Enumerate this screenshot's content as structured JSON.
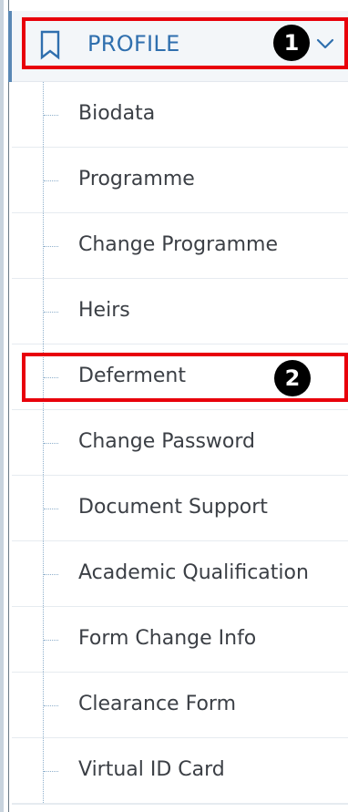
{
  "header": {
    "label": "PROFILE",
    "icon": "bookmark-icon",
    "toggle_icon": "chevron-down-icon",
    "accent_color": "#2f6fae"
  },
  "menu": {
    "items": [
      {
        "label": "Biodata"
      },
      {
        "label": "Programme"
      },
      {
        "label": "Change Programme"
      },
      {
        "label": "Heirs"
      },
      {
        "label": "Deferment"
      },
      {
        "label": "Change Password"
      },
      {
        "label": "Document Support"
      },
      {
        "label": "Academic Qualification"
      },
      {
        "label": "Form Change Info"
      },
      {
        "label": "Clearance Form"
      },
      {
        "label": "Virtual ID Card"
      }
    ]
  },
  "annotations": [
    {
      "number": "1",
      "target": "PROFILE",
      "color": "#e8000b"
    },
    {
      "number": "2",
      "target": "Deferment",
      "color": "#e8000b"
    }
  ]
}
